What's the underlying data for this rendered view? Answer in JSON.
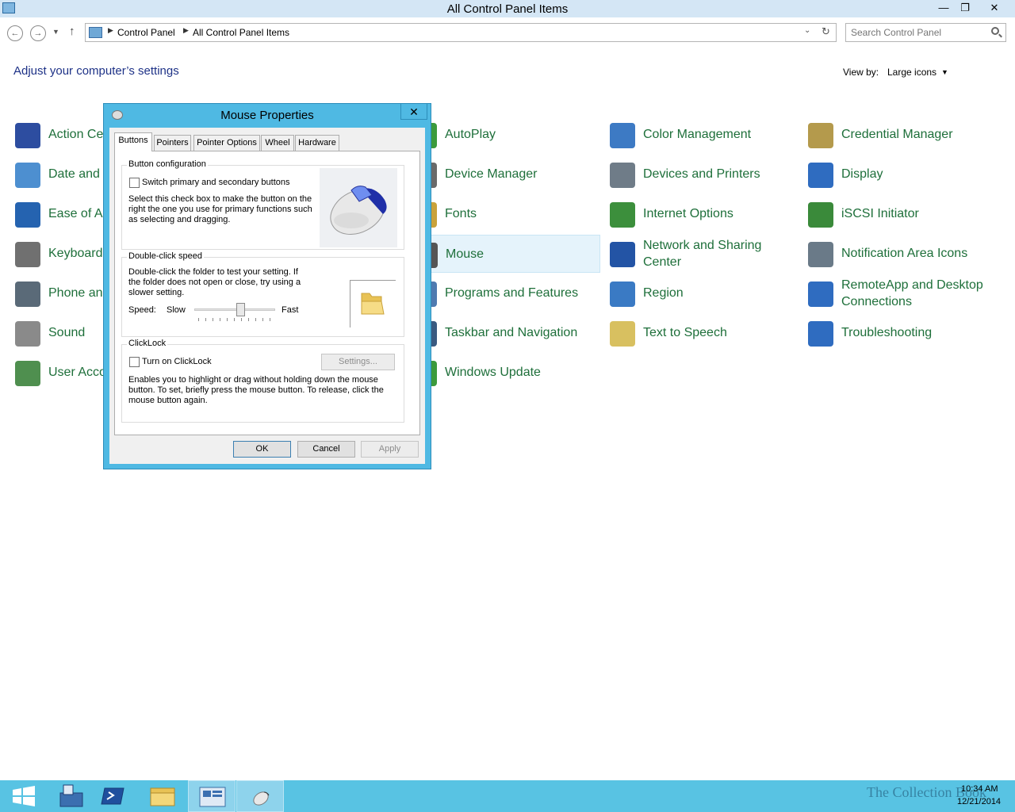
{
  "window": {
    "title": "All Control Panel Items",
    "minimize_glyph": "—",
    "maximize_glyph": "❐",
    "close_glyph": "✕"
  },
  "address": {
    "crumbs": [
      "Control Panel",
      "All Control Panel Items"
    ],
    "search_placeholder": "Search Control Panel"
  },
  "main": {
    "heading": "Adjust your computer’s settings",
    "view_by_label": "View by:",
    "view_by_value": "Large icons"
  },
  "items": [
    {
      "label": "Action Ce",
      "icon": "flag-icon",
      "color": "#2d4da0"
    },
    {
      "label": "AutoPlay",
      "icon": "autoplay-icon",
      "color": "#3c9a3c"
    },
    {
      "label": "Color Management",
      "icon": "color-management-icon",
      "color": "#3d7ac4"
    },
    {
      "label": "Credential Manager",
      "icon": "vault-icon",
      "color": "#b49a4c"
    },
    {
      "label": "Date and T",
      "icon": "calendar-clock-icon",
      "color": "#4d8fd0"
    },
    {
      "label": "Device Manager",
      "icon": "device-manager-icon",
      "color": "#6a6a6a"
    },
    {
      "label": "Devices and Printers",
      "icon": "printer-icon",
      "color": "#6f7c88"
    },
    {
      "label": "Display",
      "icon": "monitor-icon",
      "color": "#2f6cc0"
    },
    {
      "label": "Ease of Ac",
      "icon": "ease-of-access-icon",
      "color": "#2563b0"
    },
    {
      "label": "Fonts",
      "icon": "fonts-icon",
      "color": "#c9a23b"
    },
    {
      "label": "Internet Options",
      "icon": "globe-icon",
      "color": "#3c8f3c"
    },
    {
      "label": "iSCSI Initiator",
      "icon": "iscsi-globe-icon",
      "color": "#3a8a3a"
    },
    {
      "label": "Keyboard",
      "icon": "keyboard-icon",
      "color": "#707070"
    },
    {
      "label": "Mouse",
      "icon": "mouse-icon",
      "color": "#555555"
    },
    {
      "label": "Network and Sharing\nCenter",
      "icon": "network-icon",
      "color": "#2354a5"
    },
    {
      "label": "Notification Area Icons",
      "icon": "notification-area-icon",
      "color": "#6a7a88"
    },
    {
      "label": "Phone and",
      "icon": "phone-icon",
      "color": "#5a6a78"
    },
    {
      "label": "Programs and Features",
      "icon": "programs-icon",
      "color": "#4f7ab0"
    },
    {
      "label": "Region",
      "icon": "region-globe-icon",
      "color": "#3a7ac4"
    },
    {
      "label": "RemoteApp and Desktop\nConnections",
      "icon": "remoteapp-icon",
      "color": "#2f6cc0"
    },
    {
      "label": "Sound",
      "icon": "speaker-icon",
      "color": "#8a8a8a"
    },
    {
      "label": "Taskbar and Navigation",
      "icon": "taskbar-icon",
      "color": "#3a5a80"
    },
    {
      "label": "Text to Speech",
      "icon": "speech-bubble-icon",
      "color": "#d8c060"
    },
    {
      "label": "Troubleshooting",
      "icon": "troubleshooting-icon",
      "color": "#2f6cc0"
    },
    {
      "label": "User Acco",
      "icon": "users-icon",
      "color": "#4f8f4f"
    },
    {
      "label": "Windows Update",
      "icon": "windows-update-icon",
      "color": "#3c9a3c"
    }
  ],
  "dialog": {
    "title": "Mouse Properties",
    "close_glyph": "✕",
    "tabs": [
      "Buttons",
      "Pointers",
      "Pointer Options",
      "Wheel",
      "Hardware"
    ],
    "button_config": {
      "title": "Button configuration",
      "switch_label": "Switch primary and secondary buttons",
      "switch_checked": false,
      "description": "Select this check box to make the button on the right the one you use for primary functions such as selecting and dragging."
    },
    "double_click": {
      "title": "Double-click speed",
      "description": "Double-click the folder to test your setting. If the folder does not open or close, try using a slower setting.",
      "speed_label": "Speed:",
      "slow_label": "Slow",
      "fast_label": "Fast",
      "speed_value": 0.58
    },
    "clicklock": {
      "title": "ClickLock",
      "toggle_label": "Turn on ClickLock",
      "toggle_checked": false,
      "settings_label": "Settings...",
      "description": "Enables you to highlight or drag without holding down the mouse button. To set, briefly press the mouse button. To release, click the mouse button again."
    },
    "ok_label": "OK",
    "cancel_label": "Cancel",
    "apply_label": "Apply"
  },
  "taskbar": {
    "apps": [
      "start-icon",
      "server-manager-icon",
      "powershell-icon",
      "file-explorer-icon",
      "control-panel-icon",
      "mouse-icon"
    ],
    "time": "10:34 AM",
    "date": "12/21/2014",
    "watermark": "The Collection Book"
  },
  "colors": {
    "link_green": "#1e6f3a",
    "heading_blue": "#1e3287",
    "dialog_frame": "#4fb9e3",
    "taskbar": "#58c3e3"
  }
}
